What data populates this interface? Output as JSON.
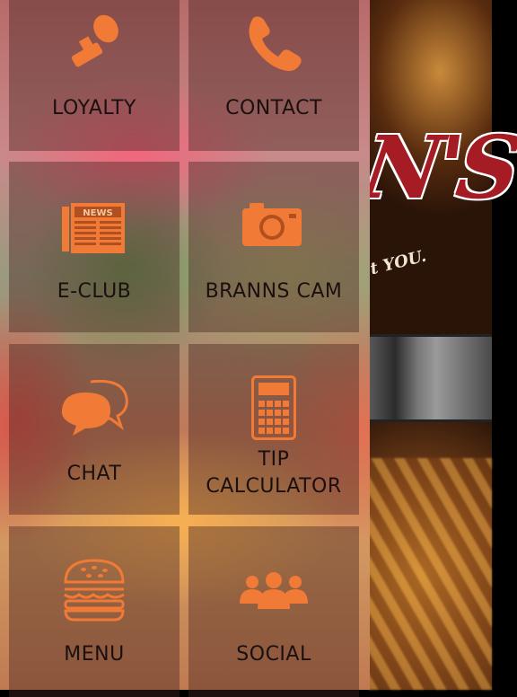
{
  "drawer": {
    "tiles": [
      {
        "id": "loyalty",
        "label_lines": [
          "LOYALTY"
        ],
        "icon": "stamp-icon"
      },
      {
        "id": "contact",
        "label_lines": [
          "CONTACT"
        ],
        "icon": "phone-icon"
      },
      {
        "id": "eclub",
        "label_lines": [
          "E-CLUB"
        ],
        "icon": "newspaper-icon"
      },
      {
        "id": "branns-cam",
        "label_lines": [
          "BRANNS CAM"
        ],
        "icon": "camera-icon"
      },
      {
        "id": "chat",
        "label_lines": [
          "CHAT"
        ],
        "icon": "chat-bubbles-icon"
      },
      {
        "id": "tip-calculator",
        "label_lines": [
          "TIP",
          "CALCULATOR"
        ],
        "icon": "calculator-icon"
      },
      {
        "id": "menu",
        "label_lines": [
          "MENU"
        ],
        "icon": "burger-icon"
      },
      {
        "id": "social",
        "label_lines": [
          "SOCIAL"
        ],
        "icon": "people-icon"
      }
    ],
    "icon_color": "#f07a36",
    "newspaper_masthead": "NEWS"
  },
  "background": {
    "logo_text": "N'S",
    "tagline": "t YOU.",
    "brand_color": "#a51c24"
  }
}
